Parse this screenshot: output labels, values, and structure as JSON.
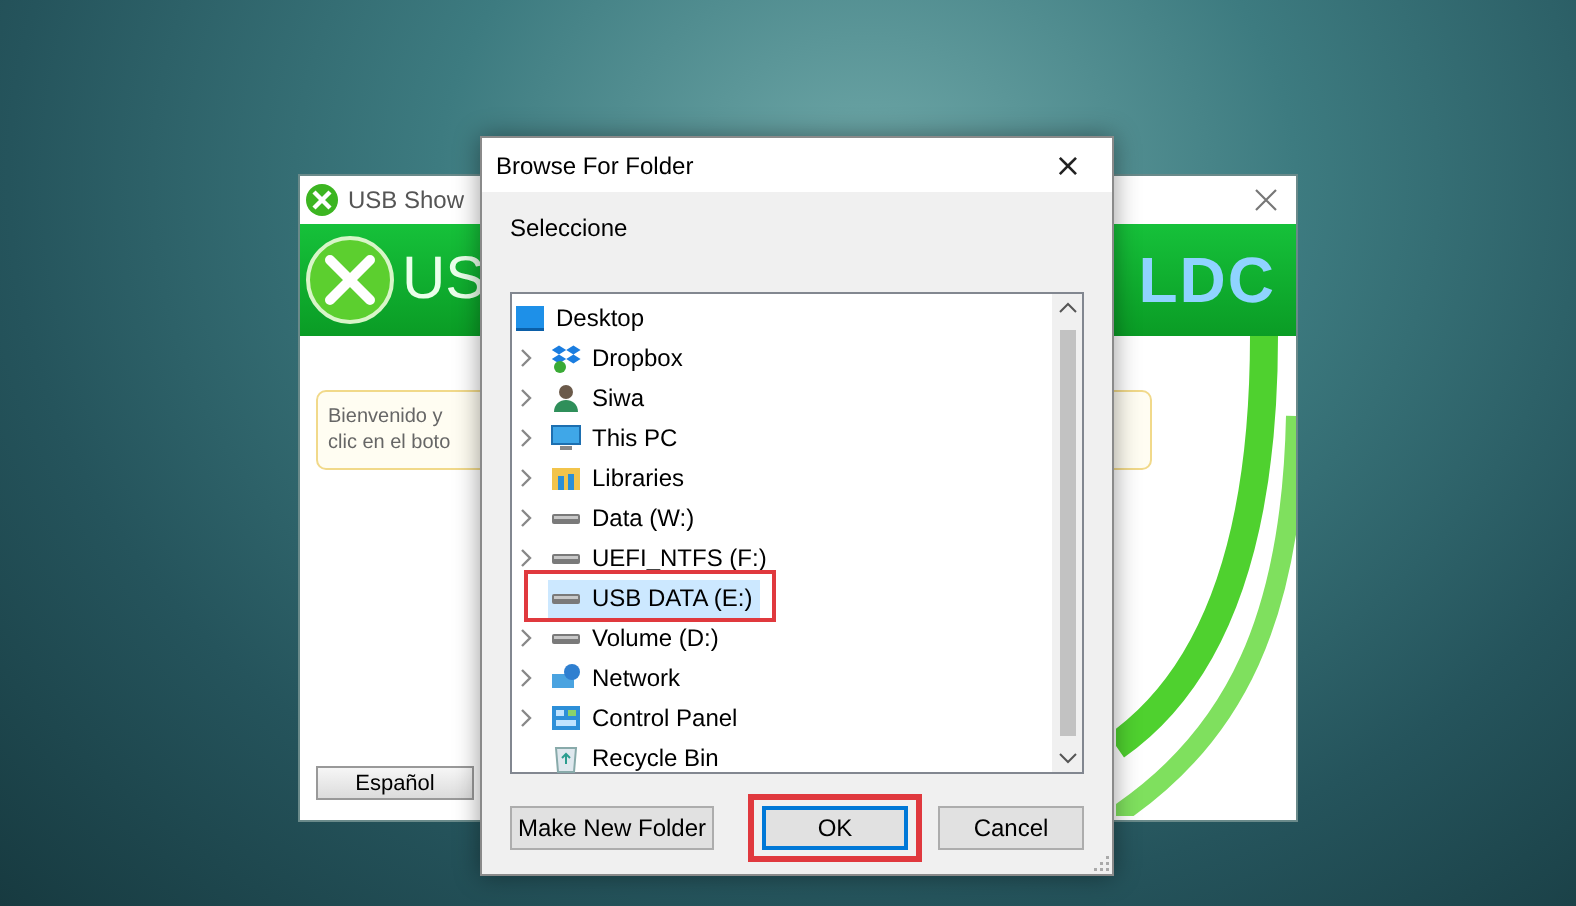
{
  "background_window": {
    "title": "USB Show",
    "banner_left": "US",
    "banner_right": "LDC",
    "message_lines": [
      "Bienvenido y",
      "clic en el boto"
    ],
    "language_button": "Español"
  },
  "dialog": {
    "title": "Browse For Folder",
    "close": "×",
    "prompt": "Seleccione",
    "tree": {
      "items": [
        {
          "label": "Desktop",
          "kind": "desktop",
          "expandable": false,
          "selected": false,
          "highlighted": false
        },
        {
          "label": "Dropbox",
          "kind": "dropbox",
          "expandable": true,
          "selected": false,
          "highlighted": false
        },
        {
          "label": "Siwa",
          "kind": "user",
          "expandable": true,
          "selected": false,
          "highlighted": false
        },
        {
          "label": "This PC",
          "kind": "pc",
          "expandable": true,
          "selected": false,
          "highlighted": false
        },
        {
          "label": "Libraries",
          "kind": "libraries",
          "expandable": true,
          "selected": false,
          "highlighted": false
        },
        {
          "label": "Data (W:)",
          "kind": "drive",
          "expandable": true,
          "selected": false,
          "highlighted": false
        },
        {
          "label": "UEFI_NTFS (F:)",
          "kind": "drive",
          "expandable": true,
          "selected": false,
          "highlighted": false
        },
        {
          "label": "USB DATA (E:)",
          "kind": "drive",
          "expandable": false,
          "selected": true,
          "highlighted": true
        },
        {
          "label": "Volume (D:)",
          "kind": "drive",
          "expandable": true,
          "selected": false,
          "highlighted": false
        },
        {
          "label": "Network",
          "kind": "network",
          "expandable": true,
          "selected": false,
          "highlighted": false
        },
        {
          "label": "Control Panel",
          "kind": "control-panel",
          "expandable": true,
          "selected": false,
          "highlighted": false
        },
        {
          "label": "Recycle Bin",
          "kind": "recycle",
          "expandable": false,
          "selected": false,
          "highlighted": false
        }
      ]
    },
    "buttons": [
      {
        "label": "Make New Folder",
        "kind": "left",
        "default": false,
        "highlighted": false
      },
      {
        "label": "OK",
        "kind": "right",
        "default": true,
        "highlighted": true
      },
      {
        "label": "Cancel",
        "kind": "right",
        "default": false,
        "highlighted": false
      }
    ]
  }
}
